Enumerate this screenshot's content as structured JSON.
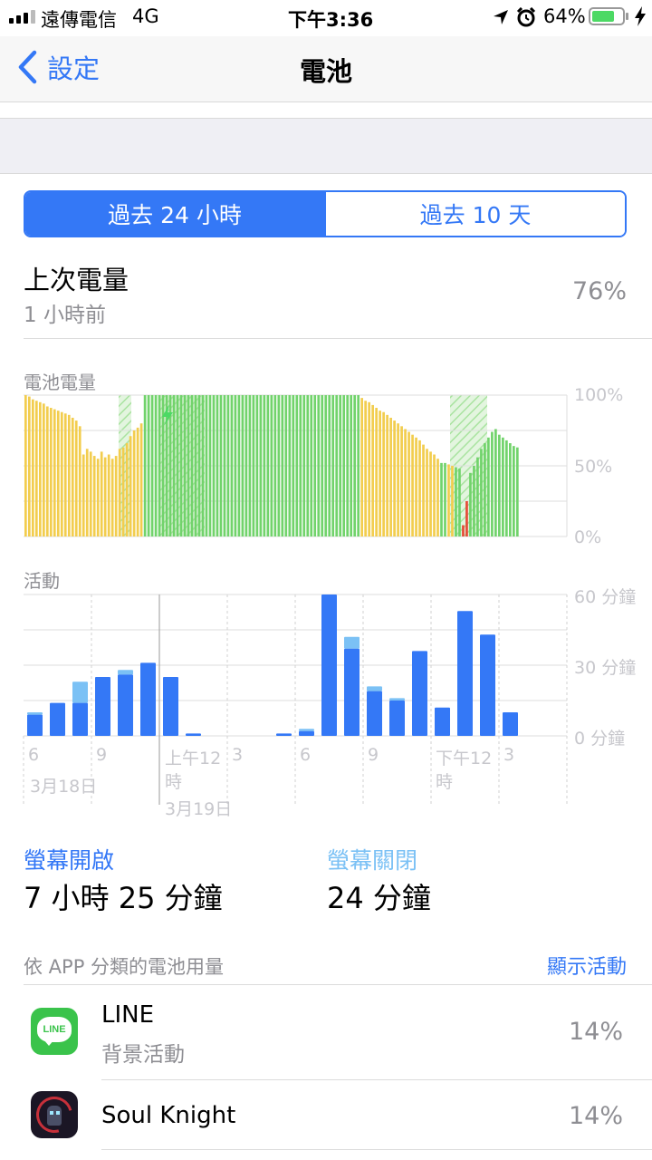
{
  "status_bar": {
    "carrier": "遠傳電信",
    "network": "4G",
    "time": "下午3:36",
    "battery_pct": "64%"
  },
  "nav": {
    "back_label": "設定",
    "title": "電池"
  },
  "segments": {
    "left": "過去 24 小時",
    "right": "過去 10 天"
  },
  "last_charge": {
    "title": "上次電量",
    "subtitle": "1 小時前",
    "value": "76%"
  },
  "battery_chart": {
    "title": "電池電量",
    "y_labels": [
      "100%",
      "50%",
      "0%"
    ]
  },
  "activity_chart": {
    "title": "活動",
    "y_labels": [
      "60 分鐘",
      "30 分鐘",
      "0 分鐘"
    ],
    "x_labels": [
      "6",
      "9",
      "上午12",
      "時",
      "3",
      "6",
      "9",
      "下午12",
      "時",
      "3"
    ],
    "dates": [
      "3月18日",
      "3月19日"
    ]
  },
  "chart_data": [
    {
      "type": "bar",
      "title": "電池電量",
      "ylim": [
        0,
        100
      ],
      "y_ticks": [
        "100%",
        "50%",
        "0%"
      ],
      "values": [
        100,
        99,
        97,
        96,
        95,
        94,
        92,
        91,
        90,
        89,
        88,
        87,
        86,
        84,
        82,
        78,
        58,
        62,
        60,
        57,
        55,
        60,
        56,
        58,
        55,
        57,
        62,
        63,
        66,
        71,
        75,
        77,
        80,
        100,
        100,
        100,
        100,
        100,
        100,
        100,
        100,
        100,
        100,
        100,
        100,
        100,
        100,
        100,
        100,
        100,
        100,
        100,
        100,
        100,
        100,
        100,
        100,
        100,
        100,
        100,
        100,
        100,
        100,
        100,
        100,
        100,
        100,
        100,
        100,
        100,
        100,
        100,
        100,
        100,
        100,
        100,
        100,
        100,
        100,
        100,
        100,
        100,
        100,
        100,
        100,
        100,
        100,
        100,
        100,
        100,
        100,
        100,
        100,
        98,
        96,
        95,
        93,
        91,
        89,
        88,
        86,
        84,
        82,
        80,
        78,
        76,
        74,
        72,
        70,
        68,
        65,
        62,
        60,
        58,
        55,
        52,
        52,
        51,
        50,
        49,
        48,
        8,
        25,
        45,
        50,
        56,
        62,
        66,
        70,
        74,
        76,
        72,
        70,
        68,
        66,
        64,
        63
      ],
      "levels": [
        "yellow",
        "green",
        "red"
      ],
      "level_colors": {
        "yellow": "#f2cd4e",
        "green": "#71d36b",
        "red": "#e64a37"
      }
    },
    {
      "type": "bar",
      "title": "活動",
      "ylim": [
        0,
        60
      ],
      "y_ticks": [
        "60 分鐘",
        "30 分鐘",
        "0 分鐘"
      ],
      "x_ticks": [
        "6",
        "9",
        "上午12時",
        "3",
        "6",
        "9",
        "下午12時",
        "3"
      ],
      "series": [
        {
          "values": [
            9,
            14,
            14,
            25,
            26,
            31,
            25,
            1,
            0,
            0,
            0,
            1,
            2,
            60,
            37,
            19,
            15,
            36,
            12,
            53,
            43,
            10
          ]
        },
        {
          "values": [
            1,
            0,
            9,
            0,
            2,
            0,
            0,
            0,
            0,
            0,
            0,
            0,
            1,
            0,
            5,
            2,
            1,
            0,
            0,
            0,
            0,
            0
          ]
        }
      ],
      "colors": [
        "#3478f6",
        "#7bc1f5"
      ]
    }
  ],
  "screen": {
    "on_label": "螢幕開啟",
    "on_value": "7 小時 25 分鐘",
    "off_label": "螢幕關閉",
    "off_value": "24 分鐘"
  },
  "usage_header": {
    "title": "依 APP 分類的電池用量",
    "action": "顯示活動"
  },
  "apps": [
    {
      "name": "LINE",
      "detail": "背景活動",
      "pct": "14%",
      "icon_text": "LINE"
    },
    {
      "name": "Soul Knight",
      "detail": "",
      "pct": "14%"
    }
  ]
}
